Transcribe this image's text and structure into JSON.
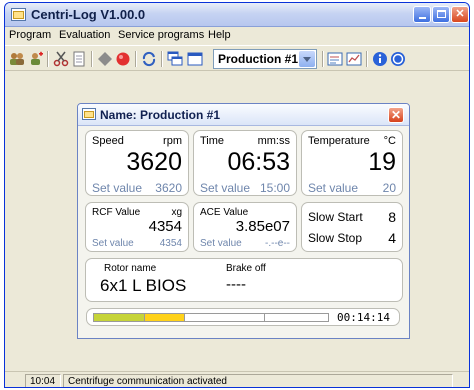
{
  "app": {
    "title": "Centri-Log V1.00.0"
  },
  "menu": {
    "items": [
      "Program",
      "Evaluation",
      "Service programs",
      "Help"
    ]
  },
  "toolbar": {
    "icons": [
      "users-icon",
      "user-add-icon",
      "scissors-icon",
      "document-icon",
      "diamond-icon",
      "record-icon",
      "refresh-icon",
      "window-cascade-icon",
      "window-icon",
      "report-icon",
      "chart-icon",
      "info-icon",
      "help-icon"
    ],
    "program_select": "Production #1"
  },
  "dialog": {
    "title": "Name: Production #1",
    "speed": {
      "label": "Speed",
      "unit": "rpm",
      "value": "3620",
      "set_label": "Set value",
      "set_value": "3620"
    },
    "time": {
      "label": "Time",
      "unit": "mm:ss",
      "value": "06:53",
      "set_label": "Set value",
      "set_value": "15:00"
    },
    "temperature": {
      "label": "Temperature",
      "unit": "°C",
      "value": "19",
      "set_label": "Set value",
      "set_value": "20"
    },
    "rcf": {
      "label": "RCF Value",
      "unit": "xg",
      "value": "4354",
      "set_label": "Set value",
      "set_value": "4354"
    },
    "ace": {
      "label": "ACE Value",
      "value": "3.85e07",
      "set_label": "Set value",
      "set_value": "-.--e--"
    },
    "slow_start": {
      "label": "Slow Start",
      "value": "8"
    },
    "slow_stop": {
      "label": "Slow Stop",
      "value": "4"
    },
    "rotor": {
      "label": "Rotor name",
      "value": "6x1 L BIOS"
    },
    "brake": {
      "label": "Brake off",
      "value": "----"
    },
    "progress": {
      "elapsed": "00:14:14",
      "fraction": 0.39,
      "green_fraction": 0.22,
      "colors": {
        "green": "#c6d43a",
        "yellow": "#ffd21a"
      }
    }
  },
  "status": {
    "time": "10:04",
    "message": "Centrifuge communication activated"
  }
}
